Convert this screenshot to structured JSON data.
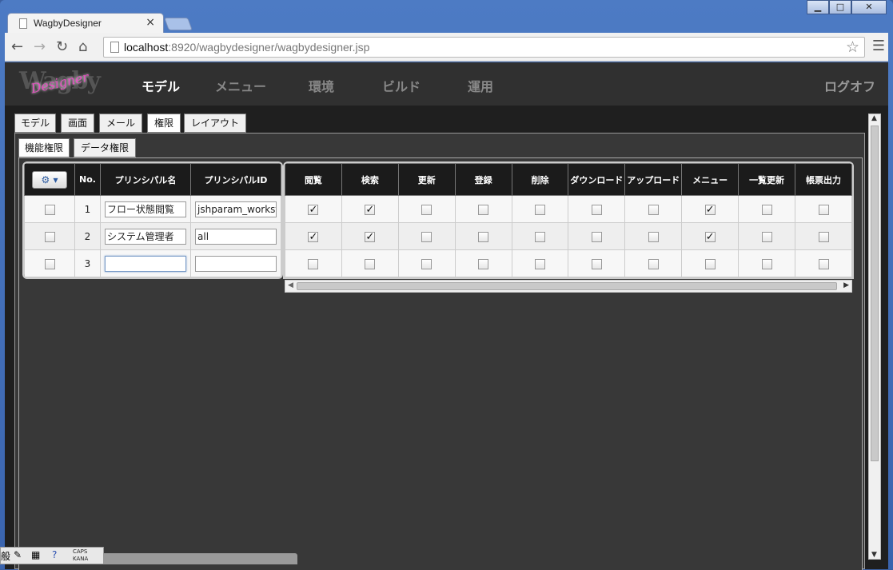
{
  "browser": {
    "tab_title": "WagbyDesigner",
    "tab_close": "×",
    "url_host": "localhost",
    "url_rest": ":8920/wagbydesigner/wagbydesigner.jsp",
    "window_buttons": {
      "minimize": "▁",
      "maximize": "□",
      "close": "✕"
    }
  },
  "app": {
    "logo_main": "Wagby",
    "logo_script": "Designer",
    "nav": [
      "モデル",
      "メニュー",
      "環境",
      "ビルド",
      "運用"
    ],
    "active_nav": "モデル",
    "logoff": "ログオフ"
  },
  "model_tabs": [
    "モデル",
    "画面",
    "メール",
    "権限",
    "レイアウト"
  ],
  "active_model_tab": "権限",
  "sub_tabs": [
    "機能権限",
    "データ権限"
  ],
  "active_sub_tab": "機能権限",
  "grid": {
    "header_button_icon": "gear-icon",
    "header_button_caret": "▾",
    "left_headers": {
      "no": "No.",
      "principal_name": "プリンシパル名",
      "principal_id": "プリンシパルID"
    },
    "right_headers": [
      "閲覧",
      "検索",
      "更新",
      "登録",
      "削除",
      "ダウンロード",
      "アップロード",
      "メニュー",
      "一覧更新",
      "帳票出力"
    ],
    "rows": [
      {
        "no": "1",
        "name": "フロー状態閲覧",
        "id": "jshparam_workst",
        "perms": [
          true,
          true,
          false,
          false,
          false,
          false,
          false,
          true,
          false,
          false
        ]
      },
      {
        "no": "2",
        "name": "システム管理者",
        "id": "all",
        "perms": [
          true,
          true,
          false,
          false,
          false,
          false,
          false,
          true,
          false,
          false
        ]
      },
      {
        "no": "3",
        "name": "",
        "id": "",
        "perms": [
          false,
          false,
          false,
          false,
          false,
          false,
          false,
          false,
          false,
          false
        ]
      }
    ]
  },
  "ime": {
    "char": "般",
    "caps": "CAPS",
    "kana": "KANA"
  }
}
